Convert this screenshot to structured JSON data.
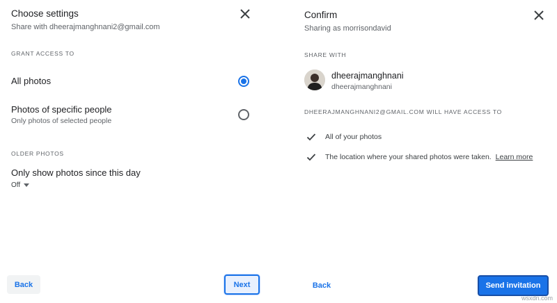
{
  "settings": {
    "title": "Choose settings",
    "subtitle": "Share with dheerajmanghnani2@gmail.com",
    "grant_access_heading": "GRANT ACCESS TO",
    "options": [
      {
        "label": "All photos",
        "sublabel": "",
        "selected": true
      },
      {
        "label": "Photos of specific people",
        "sublabel": "Only photos of selected people",
        "selected": false
      }
    ],
    "older_heading": "OLDER PHOTOS",
    "older_label": "Only show photos since this day",
    "older_value": "Off",
    "back_label": "Back",
    "next_label": "Next"
  },
  "confirm": {
    "title": "Confirm",
    "subtitle": "Sharing as morrisondavid",
    "share_with_heading": "SHARE WITH",
    "contact": {
      "name": "dheerajmanghnani",
      "email": "dheerajmanghnani"
    },
    "access_heading": "DHEERAJMANGHNANI2@GMAIL.COM WILL HAVE ACCESS TO",
    "access_items": [
      "All of your photos",
      "The location where your shared photos were taken."
    ],
    "learn_more": "Learn more",
    "back_label": "Back",
    "send_label": "Send invitation"
  },
  "icons": {
    "close": "close-icon",
    "check": "check-icon",
    "caret": "caret-down-icon"
  },
  "colors": {
    "accent": "#1a73e8",
    "text": "#202124",
    "muted": "#5f6368"
  },
  "watermark": "wsxdn.com"
}
